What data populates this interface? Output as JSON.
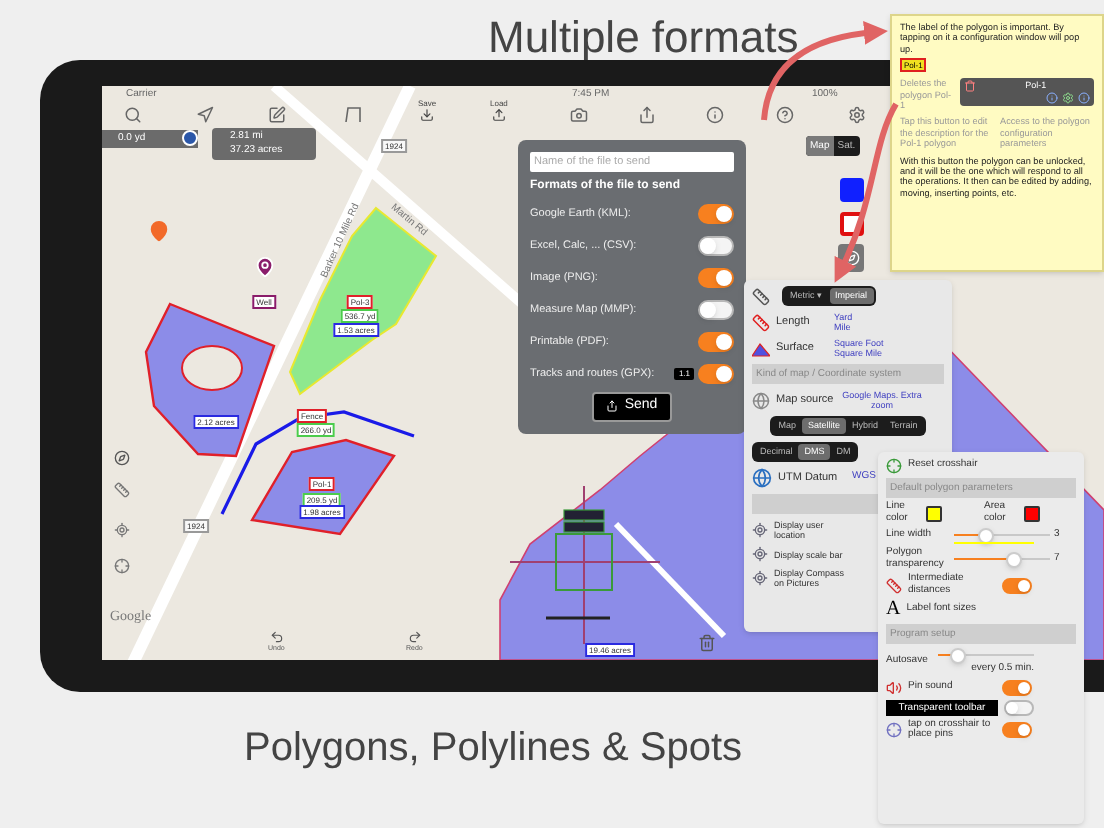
{
  "headline": "Multiple formats",
  "caption": "Polygons, Polylines & Spots",
  "status_bar": {
    "carrier": "Carrier",
    "time": "7:45 PM",
    "battery": "100%"
  },
  "toolbar": {
    "save": "Save",
    "load": "Load"
  },
  "measure": {
    "distance": "0.0 yd",
    "length": "2.81 mi",
    "area": "37.23 acres"
  },
  "map": {
    "road_names": [
      "Martin Rd",
      "Barker 10 Mile Rd"
    ],
    "labels": [
      {
        "text": "1924",
        "kind": "road"
      },
      {
        "text": "Well",
        "kind": "pin"
      },
      {
        "text": "Pol-3",
        "kind": "name"
      },
      {
        "text": "536.7 yd",
        "kind": "length"
      },
      {
        "text": "1.53 acres",
        "kind": "area"
      },
      {
        "text": "2.12 acres",
        "kind": "area"
      },
      {
        "text": "Fence",
        "kind": "name"
      },
      {
        "text": "266.0 yd",
        "kind": "length"
      },
      {
        "text": "Pol-1",
        "kind": "name"
      },
      {
        "text": "209.5 yd",
        "kind": "length"
      },
      {
        "text": "1.98 acres",
        "kind": "area"
      },
      {
        "text": "1924",
        "kind": "road"
      },
      {
        "text": "19.46 acres",
        "kind": "area"
      }
    ],
    "google": "Google",
    "undo": "Undo",
    "redo": "Redo",
    "map_type": [
      {
        "label": "Map",
        "selected": true
      },
      {
        "label": "Sat.",
        "selected": false
      }
    ]
  },
  "share": {
    "placeholder": "Name of the file to send",
    "title": "Formats of the file to send",
    "formats": [
      {
        "label": "Google Earth (KML):",
        "on": true
      },
      {
        "label": "Excel, Calc, ... (CSV):",
        "on": false
      },
      {
        "label": "Image (PNG):",
        "on": true
      },
      {
        "label": "Measure Map (MMP):",
        "on": false
      },
      {
        "label": "Printable (PDF):",
        "on": true
      },
      {
        "label": "Tracks and routes (GPX):",
        "on": true,
        "version": "1.1"
      }
    ],
    "send": "Send"
  },
  "units": {
    "systems": [
      {
        "label": "Metric ▾",
        "selected": false
      },
      {
        "label": "Imperial",
        "selected": true
      }
    ],
    "length": {
      "label": "Length",
      "units": [
        "Yard",
        "Mile"
      ]
    },
    "surface": {
      "label": "Surface",
      "units": [
        "Square Foot",
        "Square Mile"
      ]
    },
    "map_header": "Kind of map / Coordinate system",
    "map_source": {
      "label": "Map source",
      "value": "Google Maps. Extra zoom"
    },
    "map_kinds": [
      {
        "label": "Map",
        "selected": false
      },
      {
        "label": "Satellite",
        "selected": true
      },
      {
        "label": "Hybrid",
        "selected": false
      },
      {
        "label": "Terrain",
        "selected": false
      }
    ],
    "coord_formats": [
      {
        "label": "Decimal",
        "selected": false
      },
      {
        "label": "DMS",
        "selected": true
      },
      {
        "label": "DM",
        "selected": false
      }
    ],
    "datum": {
      "label": "UTM Datum",
      "value": "WGS"
    },
    "display": [
      "Display user location",
      "Display scale bar",
      "Display Compass on Pictures"
    ]
  },
  "polygon_settings": {
    "reset": "Reset crosshair",
    "header": "Default polygon parameters",
    "colors": [
      {
        "label": "Line color",
        "color": "#ffff00"
      },
      {
        "label": "Area color",
        "color": "#ff0000"
      }
    ],
    "sliders": [
      {
        "label": "Line width",
        "level": 0.3,
        "reading": "3"
      },
      {
        "label": "Polygon transparency",
        "level": 0.65,
        "reading": "7"
      }
    ],
    "intermediate": {
      "label": "Intermediate distances",
      "on": true
    },
    "font_sizes": "Label font sizes",
    "font_sizes_glyph": "A",
    "program_header": "Program setup",
    "autosave": {
      "label": "Autosave",
      "level": 0.15,
      "reading": "every 0.5 min."
    },
    "pin_sound": {
      "label": "Pin sound",
      "on": true
    },
    "transparent_toolbar": {
      "label": "Transparent toolbar",
      "on": false
    },
    "crosshair_pins": {
      "label": "tap on crosshair to place pins",
      "on": true
    }
  },
  "note": {
    "intro": "The label of the polygon is important. By tapping on it a configuration window will pop up.",
    "tag": "Pol-1",
    "delete": "Deletes the polygon Pol-1",
    "window_title": "Pol-1",
    "edit": "Tap this button to edit the description for the Pol-1 polygon",
    "access": "Access to the polygon configuration parameters",
    "unlock": "With this button the polygon can be unlocked, and it will be the one which will respond to all the operations. It then can be edited by adding, moving, inserting points, etc."
  }
}
